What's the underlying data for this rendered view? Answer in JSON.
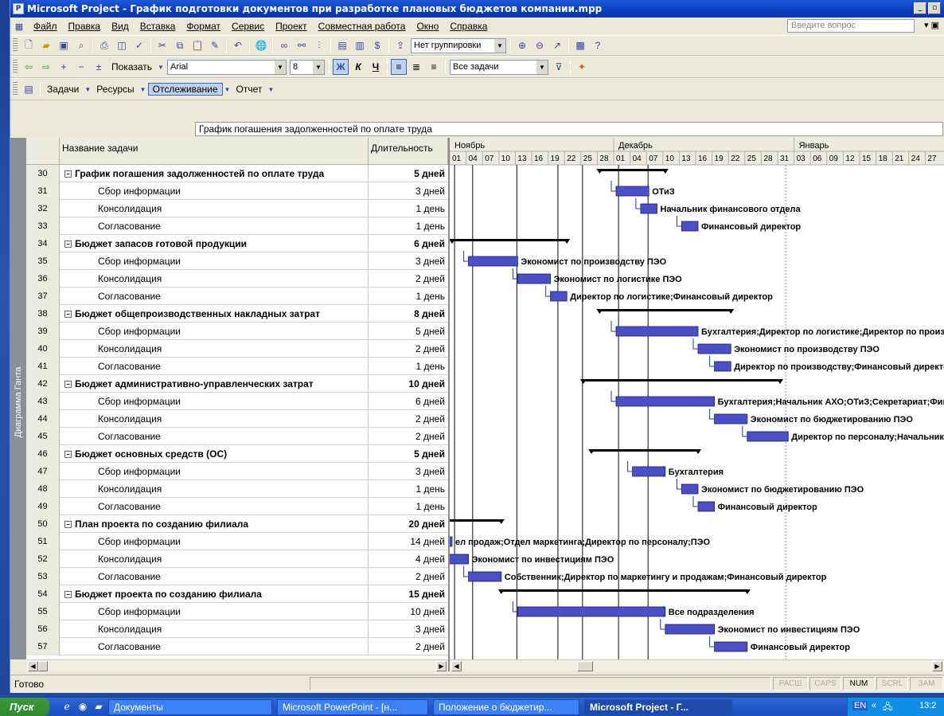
{
  "window": {
    "title": "Microsoft Project - График подготовки документов при разработке плановых бюджетов компании.mpp"
  },
  "menu": {
    "items": [
      "Файл",
      "Правка",
      "Вид",
      "Вставка",
      "Формат",
      "Сервис",
      "Проект",
      "Совместная работа",
      "Окно",
      "Справка"
    ],
    "ask_placeholder": "Введите вопрос"
  },
  "toolbar1": {
    "grouping": "Нет группировки"
  },
  "toolbar2": {
    "show_label": "Показать",
    "font": "Arial",
    "font_size": "8",
    "bold": "Ж",
    "italic": "К",
    "underline": "Ч",
    "filter": "Все задачи"
  },
  "toolbar3": {
    "tasks": "Задачи",
    "resources": "Ресурсы",
    "tracking": "Отслеживание",
    "report": "Отчет"
  },
  "entry_bar": {
    "value": "График погашения задолженностей по оплате труда"
  },
  "view_bar": {
    "label": "Диаграмма Ганта"
  },
  "grid": {
    "col_name": "Название задачи",
    "col_duration": "Длительность",
    "rows": [
      {
        "id": "30",
        "name": "График погашения задолженностей по оплате труда",
        "duration": "5 дней",
        "summary": true
      },
      {
        "id": "31",
        "name": "Сбор информации",
        "duration": "3 дней",
        "summary": false
      },
      {
        "id": "32",
        "name": "Консолидация",
        "duration": "1 день",
        "summary": false
      },
      {
        "id": "33",
        "name": "Согласование",
        "duration": "1 день",
        "summary": false
      },
      {
        "id": "34",
        "name": "Бюджет запасов готовой продукции",
        "duration": "6 дней",
        "summary": true
      },
      {
        "id": "35",
        "name": "Сбор информации",
        "duration": "3 дней",
        "summary": false
      },
      {
        "id": "36",
        "name": "Консолидация",
        "duration": "2 дней",
        "summary": false
      },
      {
        "id": "37",
        "name": "Согласование",
        "duration": "1 день",
        "summary": false
      },
      {
        "id": "38",
        "name": "Бюджет общепроизводственных накладных затрат",
        "duration": "8 дней",
        "summary": true
      },
      {
        "id": "39",
        "name": "Сбор информации",
        "duration": "5 дней",
        "summary": false
      },
      {
        "id": "40",
        "name": "Консолидация",
        "duration": "2 дней",
        "summary": false
      },
      {
        "id": "41",
        "name": "Согласование",
        "duration": "1 день",
        "summary": false
      },
      {
        "id": "42",
        "name": "Бюджет административно-управленческих затрат",
        "duration": "10 дней",
        "summary": true
      },
      {
        "id": "43",
        "name": "Сбор информации",
        "duration": "6 дней",
        "summary": false
      },
      {
        "id": "44",
        "name": "Консолидация",
        "duration": "2 дней",
        "summary": false
      },
      {
        "id": "45",
        "name": "Согласование",
        "duration": "2 дней",
        "summary": false
      },
      {
        "id": "46",
        "name": "Бюджет основных средств (ОС)",
        "duration": "5 дней",
        "summary": true
      },
      {
        "id": "47",
        "name": "Сбор информации",
        "duration": "3 дней",
        "summary": false
      },
      {
        "id": "48",
        "name": "Консолидация",
        "duration": "1 день",
        "summary": false
      },
      {
        "id": "49",
        "name": "Согласование",
        "duration": "1 день",
        "summary": false
      },
      {
        "id": "50",
        "name": "План проекта по созданию филиала",
        "duration": "20 дней",
        "summary": true
      },
      {
        "id": "51",
        "name": "Сбор информации",
        "duration": "14 дней",
        "summary": false
      },
      {
        "id": "52",
        "name": "Консолидация",
        "duration": "4 дней",
        "summary": false
      },
      {
        "id": "53",
        "name": "Согласование",
        "duration": "2 дней",
        "summary": false
      },
      {
        "id": "54",
        "name": "Бюджет проекта по созданию филиала",
        "duration": "15 дней",
        "summary": true
      },
      {
        "id": "55",
        "name": "Сбор информации",
        "duration": "10 дней",
        "summary": false
      },
      {
        "id": "56",
        "name": "Консолидация",
        "duration": "3 дней",
        "summary": false
      },
      {
        "id": "57",
        "name": "Согласование",
        "duration": "2 дней",
        "summary": false
      }
    ]
  },
  "gantt": {
    "months": [
      "Ноябрь",
      "Декабрь",
      "Январь"
    ],
    "days": [
      "01",
      "04",
      "07",
      "10",
      "13",
      "16",
      "19",
      "22",
      "25",
      "28",
      "01",
      "04",
      "07",
      "10",
      "13",
      "16",
      "19",
      "22",
      "25",
      "28",
      "31",
      "03",
      "06",
      "09",
      "12",
      "15",
      "18",
      "21",
      "24",
      "27"
    ],
    "bars": [
      {
        "row": 0,
        "type": "summary",
        "start": 9,
        "end": 13
      },
      {
        "row": 1,
        "type": "task",
        "start": 10,
        "end": 12,
        "label": "ОТиЗ"
      },
      {
        "row": 2,
        "type": "task",
        "start": 11.5,
        "end": 12.5,
        "label": "Начальник финансового отдела"
      },
      {
        "row": 3,
        "type": "task",
        "start": 14,
        "end": 15,
        "label": "Финансовый директор"
      },
      {
        "row": 4,
        "type": "summary",
        "start": 0,
        "end": 7
      },
      {
        "row": 5,
        "type": "task",
        "start": 1,
        "end": 4,
        "label": "Экономист по производству ПЭО"
      },
      {
        "row": 6,
        "type": "task",
        "start": 4,
        "end": 6,
        "label": "Экономист по логистике ПЭО"
      },
      {
        "row": 7,
        "type": "task",
        "start": 6,
        "end": 7,
        "label": "Директор по логистике;Финансовый директор"
      },
      {
        "row": 8,
        "type": "summary",
        "start": 9,
        "end": 17
      },
      {
        "row": 9,
        "type": "task",
        "start": 10,
        "end": 15,
        "label": "Бухгалтерия;Директор по логистике;Директор по производству;Служба"
      },
      {
        "row": 10,
        "type": "task",
        "start": 15,
        "end": 17,
        "label": "Экономист по производству ПЭО"
      },
      {
        "row": 11,
        "type": "task",
        "start": 16,
        "end": 17,
        "label": "Директор по производству;Финансовый директор"
      },
      {
        "row": 12,
        "type": "summary",
        "start": 8,
        "end": 20
      },
      {
        "row": 13,
        "type": "task",
        "start": 10,
        "end": 16,
        "label": "Бухгалтерия;Начальник АХО;ОТиЗ;Секретариат;Финансовый отдел"
      },
      {
        "row": 14,
        "type": "task",
        "start": 16,
        "end": 18,
        "label": "Экономист по бюджетированию ПЭО"
      },
      {
        "row": 15,
        "type": "task",
        "start": 18,
        "end": 20.5,
        "label": "Директор по персоналу;Начальник АХО;Финансовый директор"
      },
      {
        "row": 16,
        "type": "summary",
        "start": 8.5,
        "end": 15
      },
      {
        "row": 17,
        "type": "task",
        "start": 11,
        "end": 13,
        "label": "Бухгалтерия"
      },
      {
        "row": 18,
        "type": "task",
        "start": 14,
        "end": 15,
        "label": "Экономист по бюджетированию ПЭО"
      },
      {
        "row": 19,
        "type": "task",
        "start": 15,
        "end": 16,
        "label": "Финансовый директор"
      },
      {
        "row": 20,
        "type": "summary",
        "start": -2,
        "end": 3
      },
      {
        "row": 21,
        "type": "task",
        "start": -3,
        "end": 0,
        "label": "ел продаж;Отдел маркетинга;Директор по персоналу;ПЭО"
      },
      {
        "row": 22,
        "type": "task",
        "start": -1,
        "end": 1,
        "label": "Экономист по инвестициям ПЭО"
      },
      {
        "row": 23,
        "type": "task",
        "start": 1,
        "end": 3,
        "label": "Собственник;Директор по маркетингу и продажам;Финансовый директор"
      },
      {
        "row": 24,
        "type": "summary",
        "start": 3,
        "end": 18
      },
      {
        "row": 25,
        "type": "task",
        "start": 4,
        "end": 13,
        "label": "Все подразделения"
      },
      {
        "row": 26,
        "type": "task",
        "start": 13,
        "end": 16,
        "label": "Экономист по инвестициям ПЭО"
      },
      {
        "row": 27,
        "type": "task",
        "start": 16,
        "end": 18,
        "label": "Финансовый директор"
      }
    ]
  },
  "status": {
    "ready": "Готово",
    "indicators": [
      "РАСШ",
      "CAPS",
      "NUM",
      "SCRL",
      "ЗАМ"
    ],
    "active": "NUM"
  },
  "taskbar": {
    "start": "Пуск",
    "tasks": [
      "Документы",
      "Microsoft PowerPoint - [н...",
      "Положение о бюджетир...",
      "Microsoft Project - Г..."
    ],
    "active_task": "Microsoft Project - Г...",
    "lang": "EN",
    "time": "13:2"
  },
  "colors": {
    "bar_fill": "#4b4fc6",
    "summary": "#000000",
    "titlebar": "#0a3cc0"
  }
}
